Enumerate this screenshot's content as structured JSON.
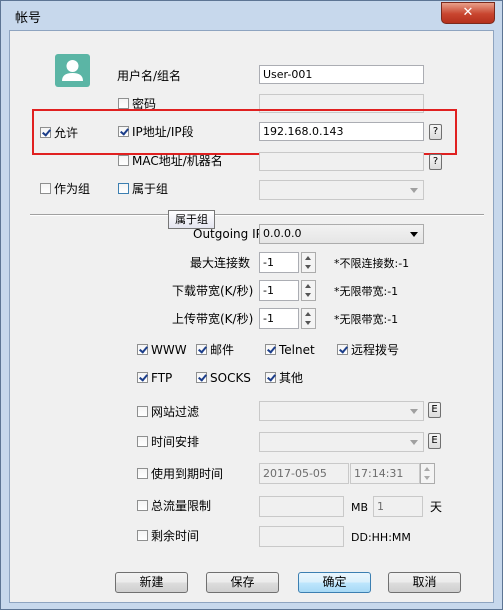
{
  "window": {
    "title": "帐号",
    "close_label": "✕"
  },
  "account": {
    "username_label": "用户名/组名",
    "username_value": "User-001",
    "password_label": "密码",
    "allow_label": "允许",
    "ip_label": "IP地址/IP段",
    "ip_value": "192.168.0.143",
    "mac_label": "MAC地址/机器名",
    "as_group_label": "作为组",
    "belongs_group_label": "属于组",
    "tooltip": "属于组",
    "help_label": "?"
  },
  "network": {
    "outgoing_ip_label": "Outgoing IP",
    "outgoing_ip_value": "0.0.0.0",
    "max_conn_label": "最大连接数",
    "max_conn_value": "-1",
    "max_conn_hint": "*不限连接数:-1",
    "download_label": "下载带宽(K/秒)",
    "download_value": "-1",
    "download_hint": "*无限带宽:-1",
    "upload_label": "上传带宽(K/秒)",
    "upload_value": "-1",
    "upload_hint": "*无限带宽:-1"
  },
  "services": {
    "www": "WWW",
    "mail": "邮件",
    "telnet": "Telnet",
    "remote": "远程拨号",
    "ftp": "FTP",
    "socks": "SOCKS",
    "other": "其他"
  },
  "limits": {
    "website_filter_label": "网站过滤",
    "schedule_label": "时间安排",
    "edit_label": "E",
    "expiry_label": "使用到期时间",
    "expiry_date": "2017-05-05",
    "expiry_time": "17:14:31",
    "quota_label": "总流量限制",
    "quota_unit": "MB",
    "quota_days": "1",
    "quota_days_unit": "天",
    "remaining_label": "剩余时间",
    "remaining_format": "DD:HH:MM"
  },
  "buttons": {
    "new": "新建",
    "save": "保存",
    "ok": "确定",
    "cancel": "取消"
  },
  "colors": {
    "highlight_box": "#e02020",
    "avatar": "#5bb5a5"
  }
}
